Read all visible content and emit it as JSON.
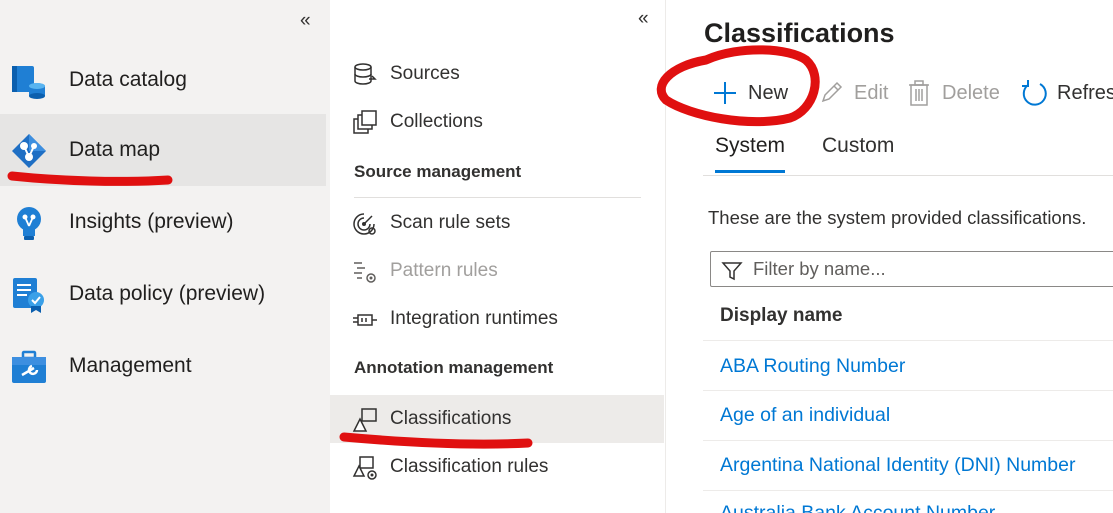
{
  "left_nav": {
    "collapse_glyph": "«",
    "items": [
      {
        "label": "Data catalog",
        "icon": "database-catalog-icon"
      },
      {
        "label": "Data map",
        "icon": "data-map-icon",
        "active": true
      },
      {
        "label": "Insights (preview)",
        "icon": "lightbulb-icon"
      },
      {
        "label": "Data policy (preview)",
        "icon": "policy-certificate-icon"
      },
      {
        "label": "Management",
        "icon": "toolbox-icon"
      }
    ]
  },
  "sub_nav": {
    "collapse_glyph": "«",
    "items_top": [
      {
        "label": "Sources",
        "icon": "sources-icon"
      },
      {
        "label": "Collections",
        "icon": "collections-icon"
      }
    ],
    "source_management": {
      "header": "Source management",
      "items": [
        {
          "label": "Scan rule sets",
          "icon": "scan-rule-sets-icon"
        },
        {
          "label": "Pattern rules",
          "icon": "pattern-rules-icon",
          "disabled": true
        },
        {
          "label": "Integration runtimes",
          "icon": "integration-runtimes-icon"
        }
      ]
    },
    "annotation_management": {
      "header": "Annotation management",
      "items": [
        {
          "label": "Classifications",
          "icon": "classifications-icon",
          "active": true
        },
        {
          "label": "Classification rules",
          "icon": "classification-rules-icon"
        }
      ]
    }
  },
  "main": {
    "title": "Classifications",
    "toolbar": {
      "new_label": "New",
      "edit_label": "Edit",
      "delete_label": "Delete",
      "refresh_label": "Refresh"
    },
    "tabs": [
      {
        "label": "System",
        "active": true
      },
      {
        "label": "Custom"
      }
    ],
    "description": "These are the system provided classifications.",
    "filter": {
      "placeholder": "Filter by name..."
    },
    "table": {
      "column_header": "Display name",
      "rows": [
        "ABA Routing Number",
        "Age of an individual",
        "Argentina National Identity (DNI) Number",
        "Australia Bank Account Number"
      ]
    }
  },
  "colors": {
    "accent": "#0078d4",
    "annotation_red": "#e01010",
    "nav_background": "#f3f2f1",
    "disabled_text": "#a19f9d"
  }
}
